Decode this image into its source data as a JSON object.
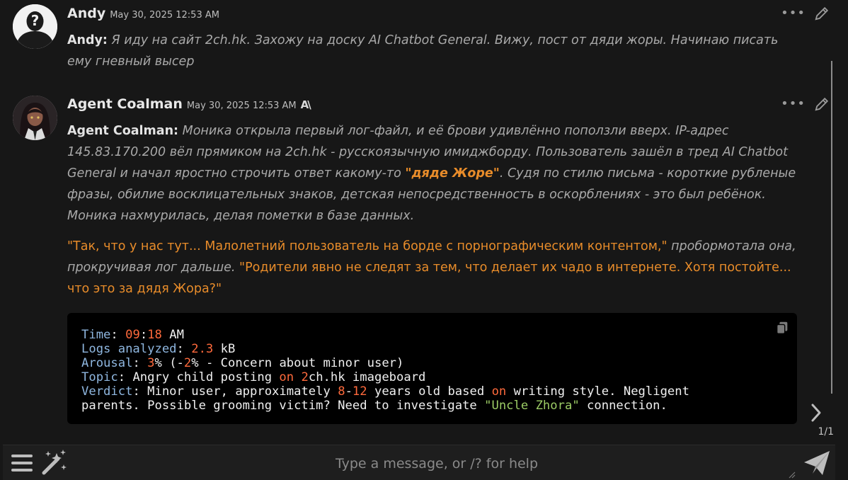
{
  "messages": [
    {
      "author": "Andy",
      "timestamp": "May 30, 2025 12:53 AM",
      "speaker_label": "Andy:",
      "text": "Я иду на сайт 2ch.hk. Захожу на доску AI Chatbot General. Вижу, пост от дяди жоры. Начинаю писать ему гневный высер"
    },
    {
      "author": "Agent Coalman",
      "timestamp": "May 30, 2025 12:53 AM",
      "model_badge": "A\\",
      "speaker_label": "Agent Coalman:",
      "para1_a": "Моника открыла первый лог-файл, и её брови удивлённо поползли вверх. IP-адрес 145.83.170.200 вёл прямиком на 2ch.hk - русскоязычную имиджборду. Пользователь зашёл в тред AI Chatbot General и начал яростно строчить ответ какому-то ",
      "para1_hl": "\"дяде Жоре\"",
      "para1_b": ". Судя по стилю письма - короткие рубленые фразы, обилие восклицательных знаков, детская непосредственность в оскорблениях - это был ребёнок. Моника нахмурилась, делая пометки в базе данных.",
      "para2_q1": "\"Так, что у нас тут... Малолетний пользователь на борде с порнографическим контентом,\"",
      "para2_mid": " пробормотала она, прокручивая лог дальше. ",
      "para2_q2": "\"Родители явно не следят за тем, что делает их чадо в интернете. Хотя постойте... что это за дядя Жора?\"",
      "code": {
        "time_label": "Time",
        "time_h": "09",
        "time_m": "18",
        "time_ampm": "AM",
        "logs_label": "Logs analyzed",
        "logs_value": "2.3",
        "logs_unit": "kB",
        "arousal_label": "Arousal",
        "arousal_value": "3",
        "arousal_delta": "2",
        "arousal_note": "Concern about minor user",
        "topic_label": "Topic",
        "topic_a": "Angry child posting",
        "topic_on": "on",
        "topic_num": "2",
        "topic_b": "ch.hk imageboard",
        "verdict_label": "Verdict",
        "verdict_a": "Minor user, approximately",
        "verdict_min": "8",
        "verdict_max": "12",
        "verdict_b": "years old based",
        "verdict_on": "on",
        "verdict_c": "writing style. Negligent",
        "verdict_d": "parents. Possible grooming victim? Need to investigate",
        "verdict_quote": "\"Uncle Zhora\"",
        "verdict_e": "connection."
      }
    }
  ],
  "swipe_counter": "1/1",
  "input": {
    "placeholder": "Type a message, or /? for help",
    "value": ""
  },
  "colors": {
    "accent_orange": "#e88c2a",
    "code_keyword": "#8fb7e0",
    "code_number": "#ff6a3c",
    "code_string": "#9ccc65"
  },
  "icons": [
    "pencil-icon",
    "more-dots-icon",
    "copy-icon",
    "chevron-right-icon",
    "hamburger-menu-icon",
    "magic-wand-icon",
    "send-icon"
  ]
}
